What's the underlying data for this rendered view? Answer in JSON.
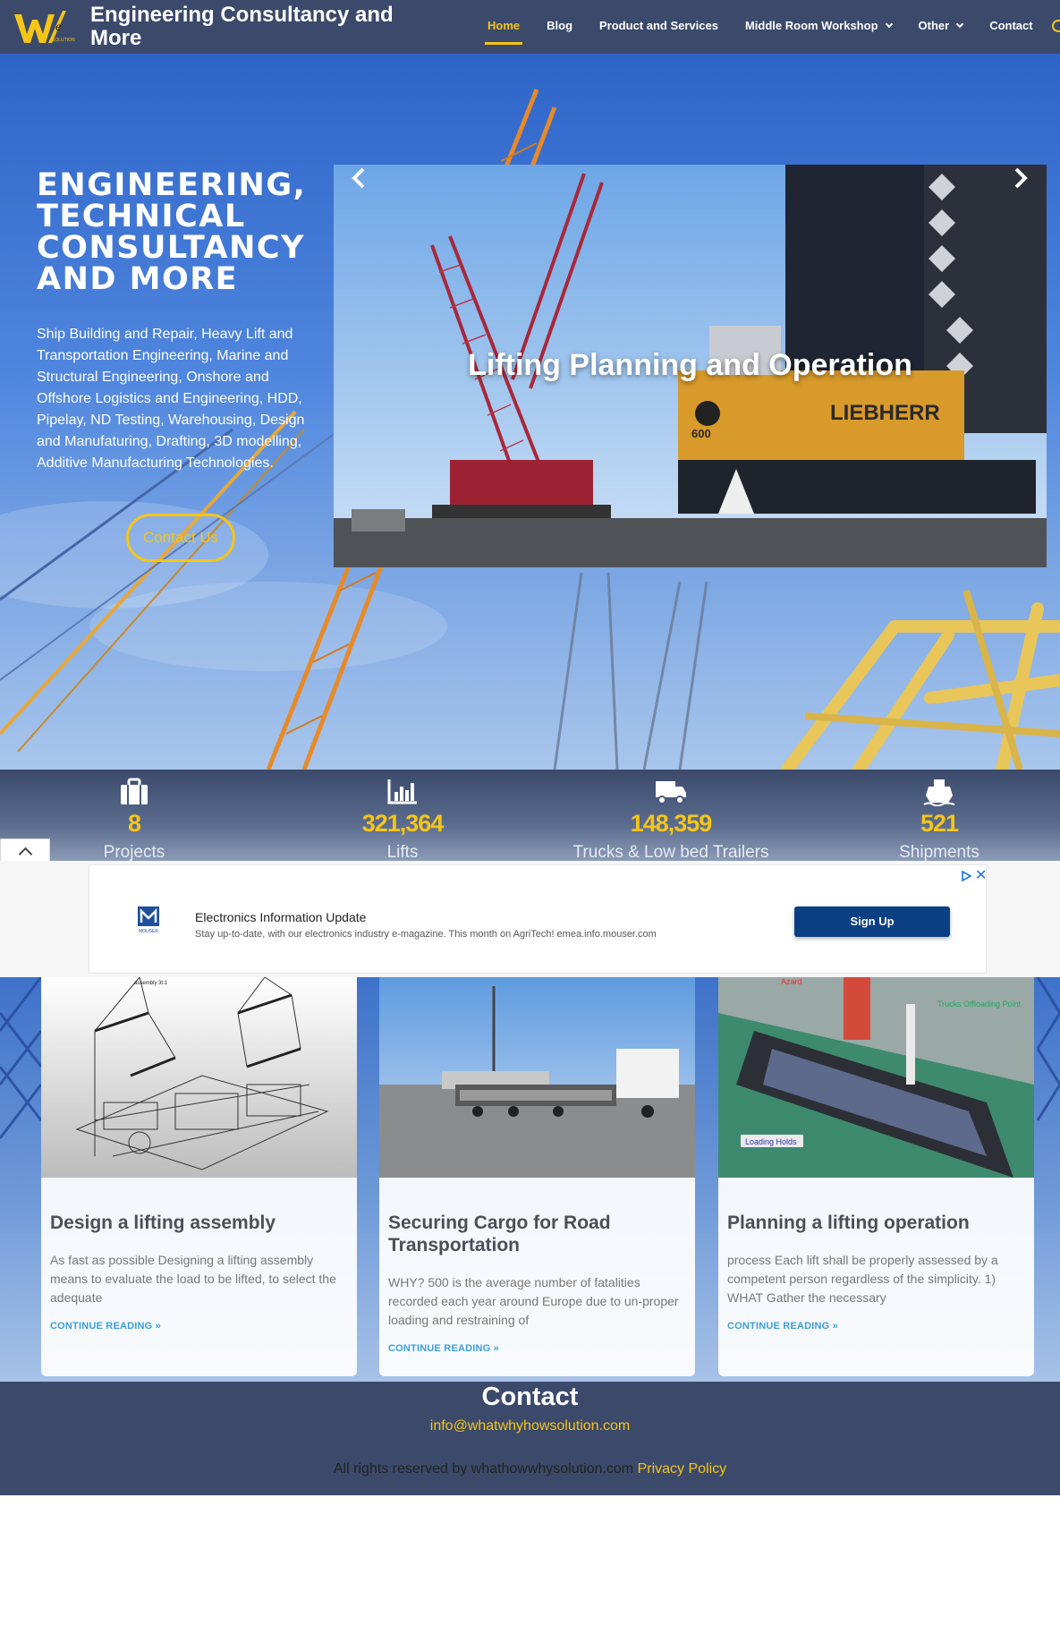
{
  "header": {
    "site_title": "Engineering Consultancy and More",
    "logo_text": "WE SOLUTION",
    "nav": [
      {
        "label": "Home",
        "active": true
      },
      {
        "label": "Blog"
      },
      {
        "label": "Product and Services"
      },
      {
        "label": "Middle Room Workshop",
        "dropdown": true
      },
      {
        "label": "Other",
        "dropdown": true
      },
      {
        "label": "Contact"
      }
    ]
  },
  "hero": {
    "heading": "ENGINEERING, TECHNICAL CONSULTANCY AND MORE",
    "text": "Ship Building and Repair, Heavy Lift and Transportation Engineering, Marine and Structural Engineering, Onshore and Offshore Logistics and Engineering, HDD, Pipelay, ND Testing, Warehousing, Design and Manufaturing, Drafting, 3D modelling, Additive Manufacturing Technologies.",
    "button": "Contact Us",
    "slide_caption": "Lifting Planning and Operation",
    "slide_crane_text": "LIEBHERR",
    "slide_crane_number": "600"
  },
  "stats": [
    {
      "icon": "briefcase-icon",
      "value": "8",
      "label": "Projects"
    },
    {
      "icon": "bar-chart-icon",
      "value": "321,364",
      "label": "Lifts"
    },
    {
      "icon": "truck-icon",
      "value": "148,359",
      "label": "Trucks & Low bed Trailers"
    },
    {
      "icon": "ship-icon",
      "value": "521",
      "label": "Shipments"
    }
  ],
  "ad": {
    "title": "Electronics Information Update",
    "description": "Stay up-to-date, with our electronics industry e-magazine. This month on AgriTech! emea.info.mouser.com",
    "button": "Sign Up",
    "brand": "MOUSER"
  },
  "posts": [
    {
      "title": "Design a lifting assembly",
      "excerpt": "As fast as possible Designing a lifting assembly means to evaluate the load to be lifted, to select the adequate",
      "more": "CONTINUE READING »",
      "thumb_caption": "assembly 3t:1"
    },
    {
      "title": "Securing Cargo for Road Transportation",
      "excerpt": "WHY? 500 is the average number of fatalities recorded each year around Europe due to un-proper loading and restraining of",
      "more": "CONTINUE READING »"
    },
    {
      "title": "Planning a lifting operation",
      "excerpt": "process Each lift shall be properly assessed by a competent person regardless of the simplicity. 1) WHAT Gather the necessary",
      "more": "CONTINUE READING »",
      "thumb_labels": [
        "Azard",
        "Trucks Offloading Point",
        "Loading Holds"
      ]
    }
  ],
  "footer": {
    "title": "Contact",
    "email": "info@whatwhyhowsolution.com",
    "rights": "All rights reserved by whathowwhysolution.com",
    "privacy": "Privacy Policy"
  },
  "colors": {
    "accent": "#f5c518",
    "header_bg": "#3b4a6b",
    "link": "#3b9fd8",
    "ad_button": "#0b3f84"
  }
}
